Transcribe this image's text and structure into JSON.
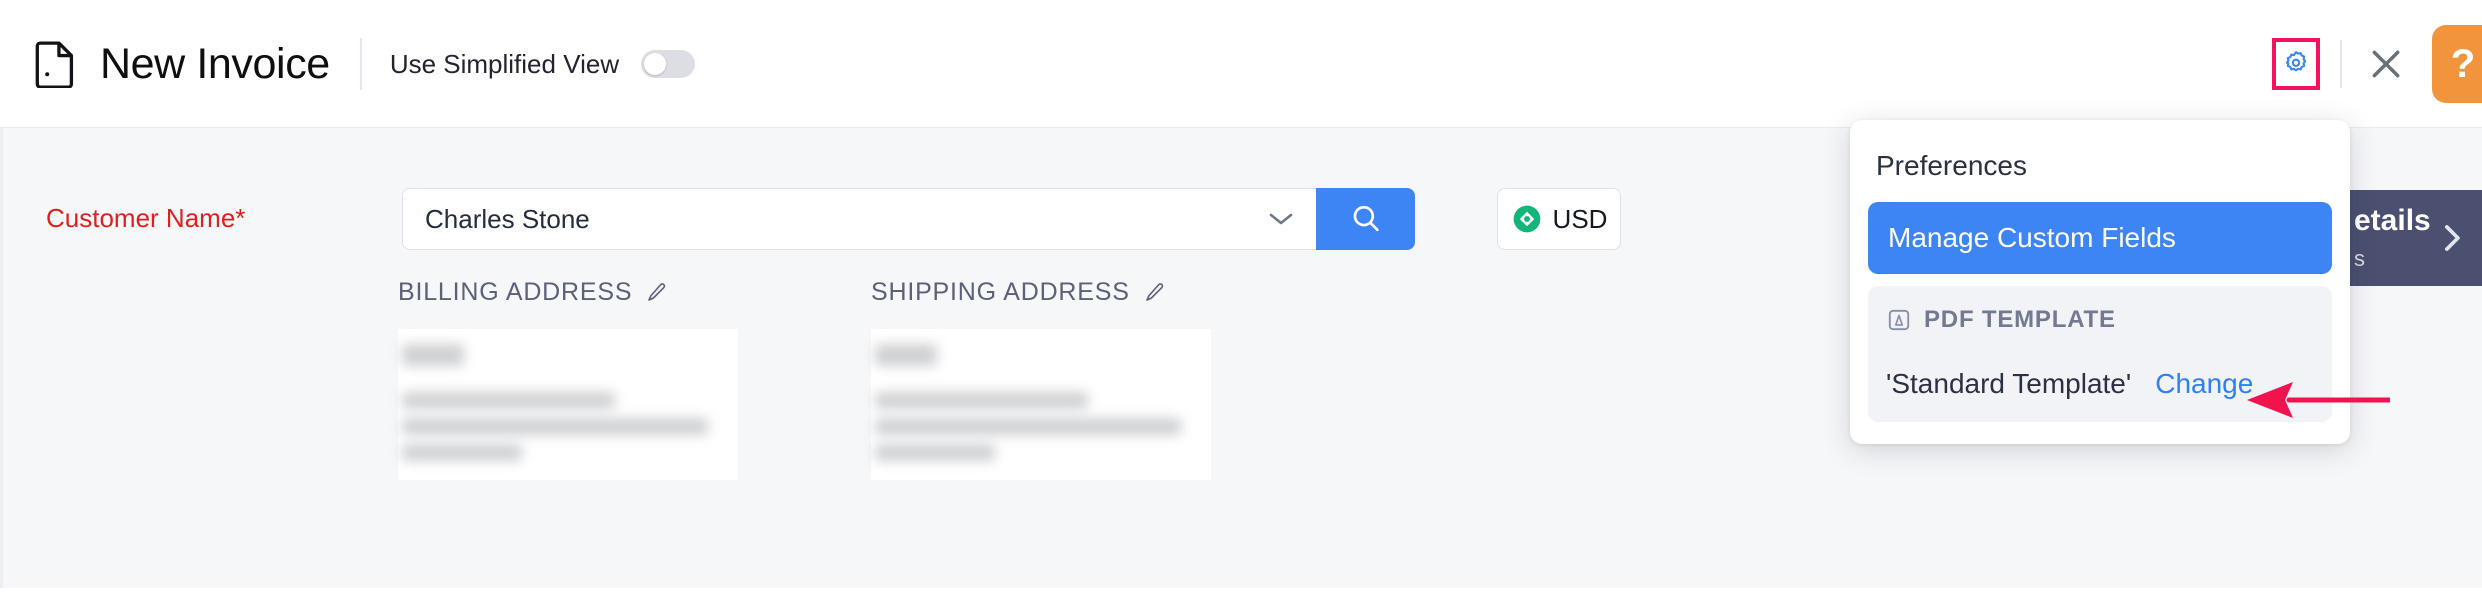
{
  "header": {
    "doc_icon": "document-icon",
    "title": "New Invoice",
    "simplified_view_label": "Use Simplified View",
    "simplified_view_state": "off",
    "gear_icon": "gear-icon",
    "close_icon": "close-icon",
    "help_label": "?",
    "accent_highlight_color": "#f4115f",
    "help_button_color": "#f2943c",
    "gear_icon_color": "#3d85f4"
  },
  "form": {
    "customer_label": "Customer Name*",
    "customer_label_color": "#e02020",
    "customer_value": "Charles Stone",
    "customer_placeholder": "Customer Name",
    "dropdown_icon": "chevron-down-icon",
    "search_icon": "search-icon",
    "search_button_color": "#3d85f4",
    "currency_code": "USD",
    "currency_icon": "currency-coin-icon",
    "currency_icon_color": "#12b57a"
  },
  "addresses": {
    "billing": {
      "heading": "BILLING ADDRESS",
      "edit_icon": "pencil-icon",
      "lines": [
        "",
        "",
        "",
        ""
      ],
      "redacted": true
    },
    "shipping": {
      "heading": "SHIPPING ADDRESS",
      "edit_icon": "pencil-icon",
      "lines": [
        "",
        "",
        "",
        ""
      ],
      "redacted": true
    }
  },
  "side_panel": {
    "title": "etails",
    "subtitle": "s",
    "chevron_icon": "chevron-right-icon",
    "background_color": "#4b5070"
  },
  "dropdown": {
    "header": "Preferences",
    "active_item": "Manage Custom Fields",
    "active_color": "#3d85f4",
    "section": {
      "icon": "pdf-file-icon",
      "title": "PDF TEMPLATE",
      "value": "'Standard Template'",
      "action": "Change",
      "action_color": "#2f80f5"
    }
  },
  "annotation": {
    "arrow_icon": "left-arrow-annotation",
    "color": "#f0134d"
  }
}
